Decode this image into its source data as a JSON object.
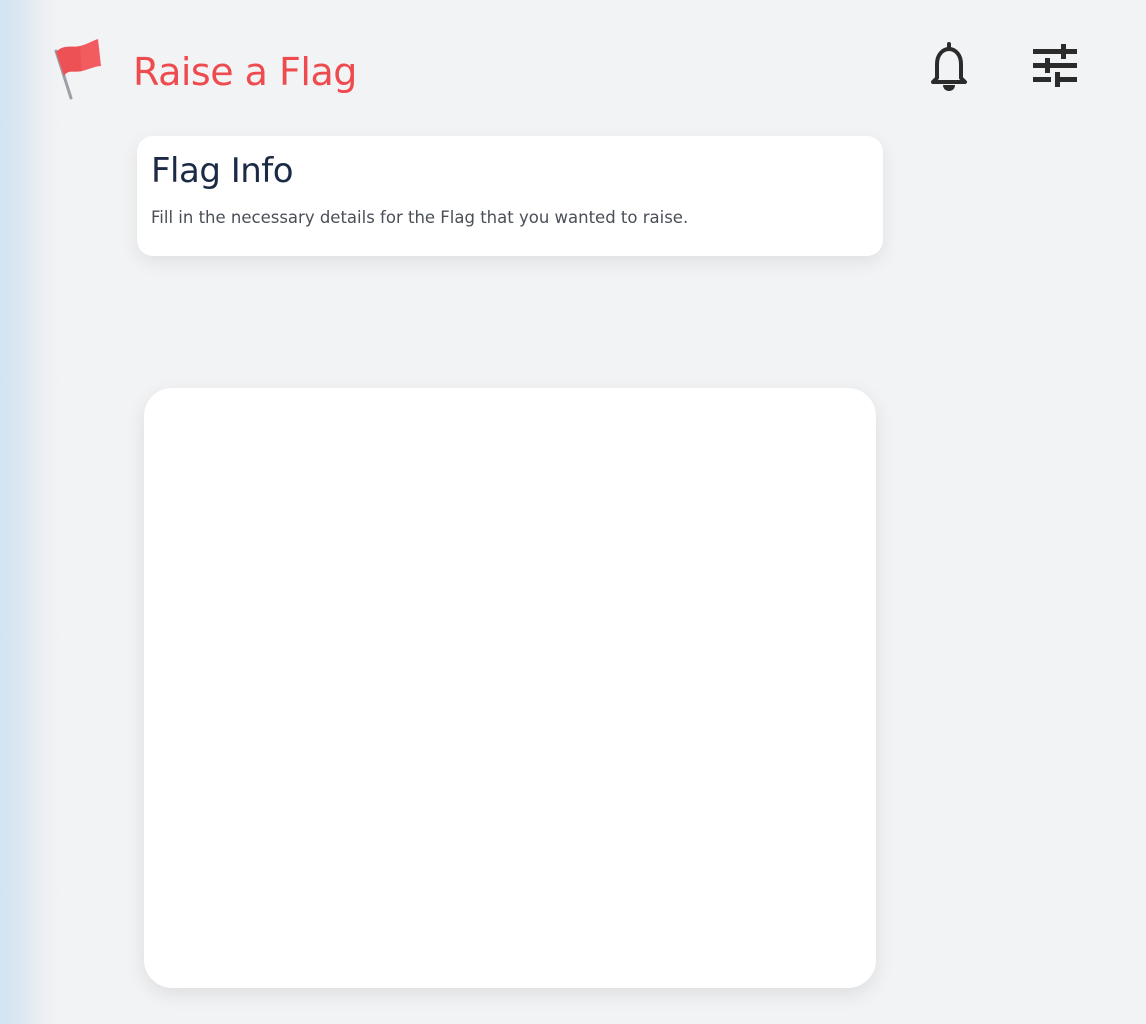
{
  "header": {
    "title": "Raise a Flag",
    "logo_icon": "red-flag-icon",
    "notifications_icon": "bell-icon",
    "filter_icon": "sliders-icon"
  },
  "info_card": {
    "title": "Flag Info",
    "description": "Fill in the necessary details for the Flag that you wanted to raise."
  },
  "colors": {
    "accent": "#ee4b4f",
    "title_text": "#1b2a45",
    "background": "#f2f3f5",
    "card": "#ffffff"
  }
}
